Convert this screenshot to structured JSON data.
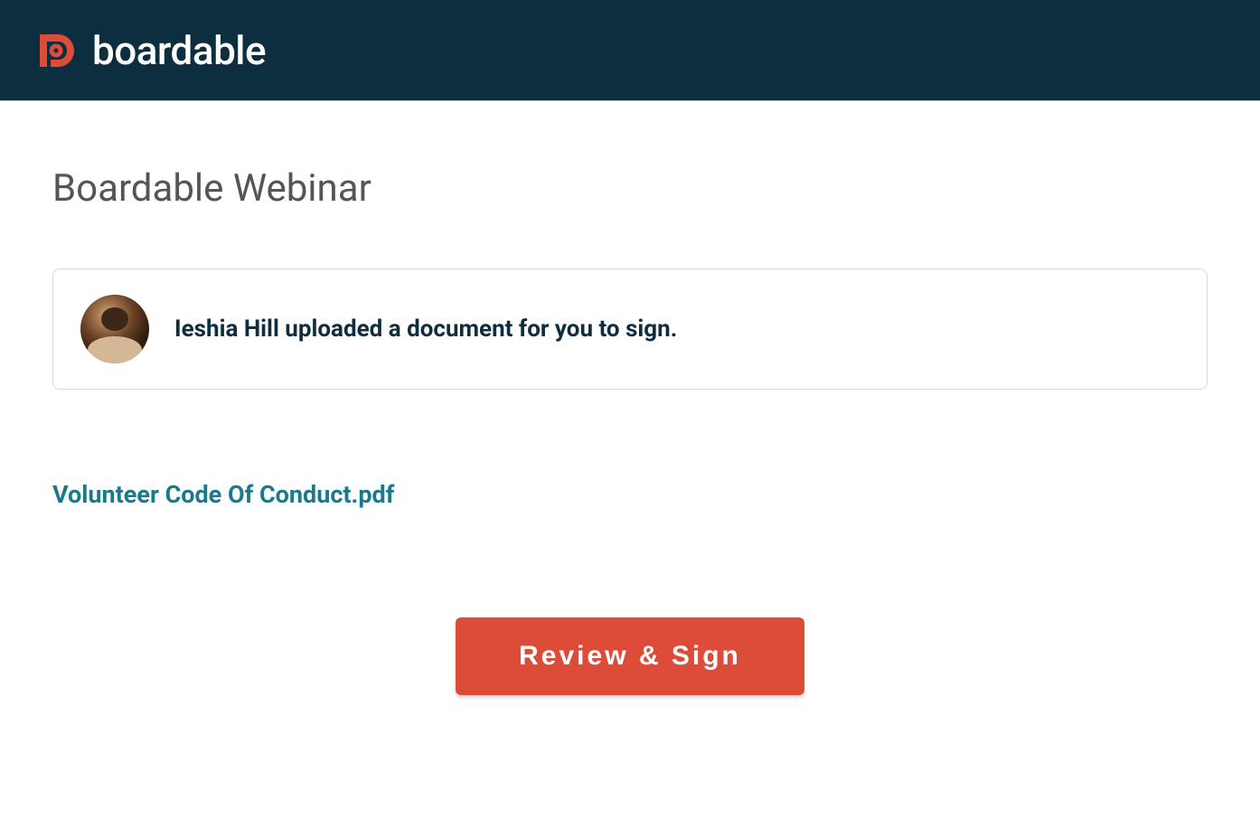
{
  "header": {
    "logo_text": "boardable"
  },
  "page": {
    "title": "Boardable Webinar"
  },
  "notification": {
    "message": "Ieshia Hill uploaded a document for you to sign."
  },
  "document": {
    "name": "Volunteer Code Of Conduct.pdf"
  },
  "action": {
    "button_label": "Review & Sign"
  }
}
